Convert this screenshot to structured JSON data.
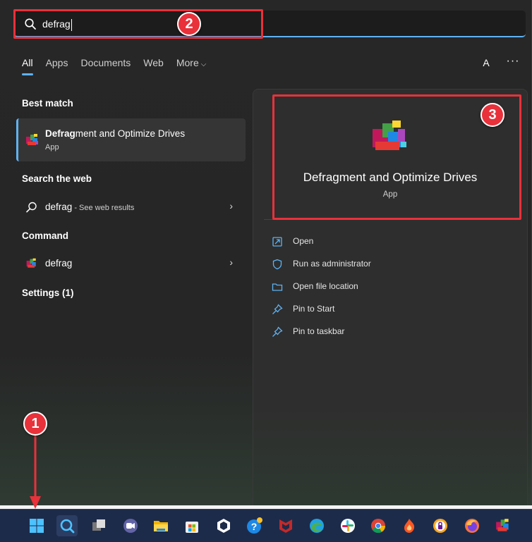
{
  "search": {
    "query": "defrag"
  },
  "tabs": [
    {
      "label": "All"
    },
    {
      "label": "Apps"
    },
    {
      "label": "Documents"
    },
    {
      "label": "Web"
    },
    {
      "label": "More",
      "chevron": "⌵"
    }
  ],
  "header": {
    "avatar_letter": "A",
    "more_options": "···"
  },
  "sections": {
    "best_match": "Best match",
    "search_web": "Search the web",
    "command": "Command",
    "settings": "Settings (1)"
  },
  "best_match": {
    "title_bold": "Defrag",
    "title_rest": "ment and Optimize Drives",
    "subtitle": "App"
  },
  "web_result": {
    "query": "defrag",
    "suffix": " - See web results",
    "chevron": "›"
  },
  "command_result": {
    "label": "defrag",
    "chevron": "›"
  },
  "preview": {
    "title": "Defragment and Optimize Drives",
    "subtitle": "App",
    "actions": [
      {
        "label": "Open",
        "icon": "open-icon"
      },
      {
        "label": "Run as administrator",
        "icon": "shield-icon"
      },
      {
        "label": "Open file location",
        "icon": "folder-icon"
      },
      {
        "label": "Pin to Start",
        "icon": "pin-icon"
      },
      {
        "label": "Pin to taskbar",
        "icon": "pin-icon"
      }
    ]
  },
  "annotations": {
    "one": "1",
    "two": "2",
    "three": "3"
  },
  "colors": {
    "accent": "#5fb2f2",
    "annotation": "#e8313a",
    "taskbar": "#1d2b4a"
  },
  "taskbar_icons": [
    "start-icon",
    "search-icon",
    "task-view-icon",
    "teams-icon",
    "file-explorer-icon",
    "store-icon",
    "mail-icon",
    "help-icon",
    "mcafee-icon",
    "edge-icon",
    "slack-icon",
    "chrome-icon",
    "app-icon",
    "vpn-icon",
    "firefox-icon",
    "defrag-icon"
  ]
}
